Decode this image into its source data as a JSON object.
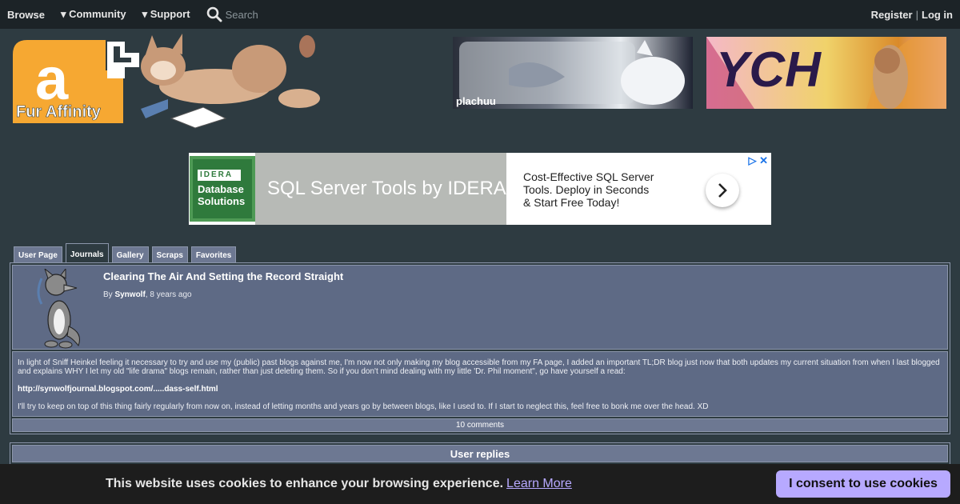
{
  "nav": {
    "browse": "Browse",
    "community": "▾ Community",
    "support": "▾ Support",
    "search_placeholder": "Search",
    "register": "Register",
    "separator": "|",
    "login": "Log in"
  },
  "logo": {
    "text": "Fur Affinity",
    "mark": "a"
  },
  "banners": [
    {
      "label": "plachuu"
    },
    {
      "label": "YCH"
    }
  ],
  "ad": {
    "brand": "IDERA",
    "logo_text": "Database Solutions",
    "headline": "SQL Server Tools by IDERA",
    "body": "Cost-Effective SQL Server Tools. Deploy in Seconds & Start Free Today!",
    "badge": "▷ ✕"
  },
  "tabs": [
    {
      "label": "User Page",
      "active": false
    },
    {
      "label": "Journals",
      "active": true
    },
    {
      "label": "Gallery",
      "active": false
    },
    {
      "label": "Scraps",
      "active": false
    },
    {
      "label": "Favorites",
      "active": false
    }
  ],
  "journal": {
    "title": "Clearing The Air And Setting the Record Straight",
    "by": "By ",
    "author": "Synwolf",
    "age": ", 8 years ago",
    "paragraph1": "In light of Sniff Heinkel feeling it necessary to try and use my (public) past blogs against me, I'm now not only making my blog accessible from my FA page, I added an important TL;DR blog just now that both updates my current situation from when I last blogged and explains WHY I let my old \"life drama\" blogs remain, rather than just deleting them. So if you don't mind dealing with my little 'Dr. Phil moment\", go have yourself a read:",
    "link": "http://synwolfjournal.blogspot.com/.....dass-self.html",
    "paragraph2": "I'll try to keep on top of this thing fairly regularly from now on, instead of letting months and years go by between blogs, like I used to. If I start to neglect this, feel free to bonk me over the head. XD",
    "comments": "10 comments"
  },
  "replies": {
    "header": "User replies"
  },
  "cookie": {
    "message": "This website uses cookies to enhance your browsing experience.",
    "learn_more": "Learn More",
    "consent": "I consent to use cookies"
  },
  "colors": {
    "page_bg": "#2e3b41",
    "nav_bg": "#1c2327",
    "panel": "#5e6a85",
    "tab": "#6d7892",
    "logo_orange": "#f6a832",
    "cookie_button": "#b7a9ff"
  }
}
